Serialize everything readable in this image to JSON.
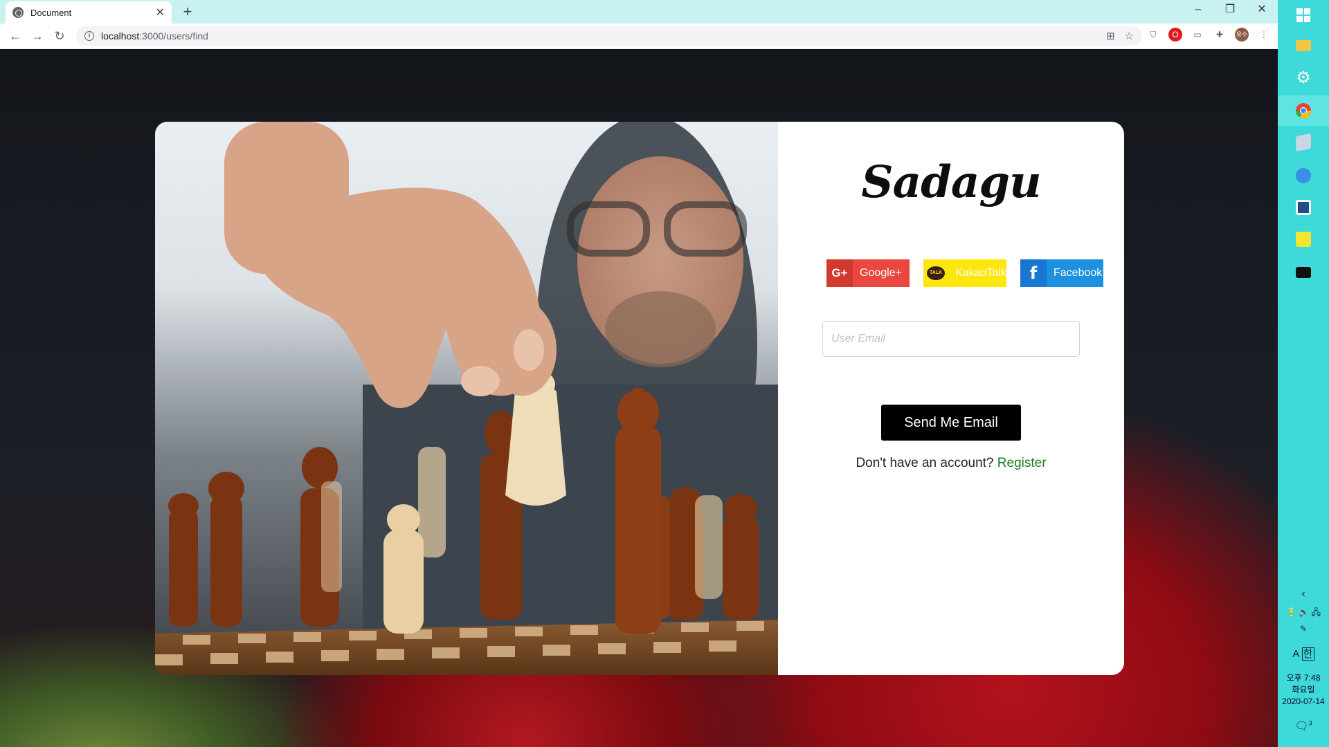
{
  "browser": {
    "tab_title": "Document",
    "url_host": "localhost",
    "url_path": ":3000/users/find",
    "profile_initial": "유수"
  },
  "login": {
    "logo": "Sadagu",
    "social": [
      {
        "label": "Google+",
        "icon": "G+",
        "color": "#e9473f"
      },
      {
        "label": "KakaoTalk",
        "icon": "TALK",
        "color": "#fce60b"
      },
      {
        "label": "Facebook",
        "icon": "f",
        "color": "#1e90e0"
      }
    ],
    "email_placeholder": "User Email",
    "send_label": "Send Me Email",
    "register_prompt": "Don't have an account?",
    "register_link": "Register"
  },
  "taskbar": {
    "clock_time": "오후 7:48",
    "clock_day": "화요일",
    "clock_date": "2020-07-14",
    "ime_a": "A",
    "ime_han": "한",
    "notification_count": "3"
  }
}
